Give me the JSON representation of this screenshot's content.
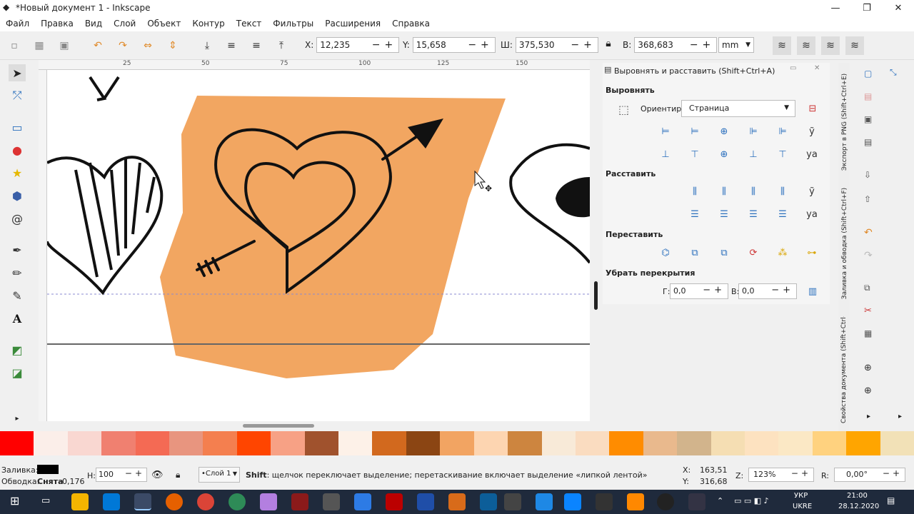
{
  "window": {
    "title": "*Новый документ 1 - Inkscape",
    "min": "—",
    "max": "❐",
    "close": "✕"
  },
  "menu": [
    "Файл",
    "Правка",
    "Вид",
    "Слой",
    "Объект",
    "Контур",
    "Текст",
    "Фильтры",
    "Расширения",
    "Справка"
  ],
  "toolbar": {
    "x_label": "X:",
    "x_value": "12,235",
    "y_label": "Y:",
    "y_value": "15,658",
    "w_label": "Ш:",
    "w_value": "375,530",
    "h_label": "В:",
    "h_value": "368,683",
    "unit": "mm"
  },
  "ruler": {
    "ticks": [
      "25",
      "50",
      "75",
      "100",
      "125",
      "150"
    ]
  },
  "canvas": {
    "accent": "#F2A661"
  },
  "panel": {
    "title": "Выровнять и расставить (Shift+Ctrl+A)",
    "align_header": "Выровнять",
    "relative_label": "Ориентир:",
    "relative_value": "Страница",
    "distribute_header": "Расставить",
    "rearrange_header": "Переставить",
    "overlap_header": "Убрать перекрытия",
    "h_gap_label": "Г:",
    "h_gap_value": "0,0",
    "v_gap_label": "В:",
    "v_gap_value": "0,0"
  },
  "dock_tabs": [
    "Экспорт в PNG (Shift+Ctrl+E)",
    "Заливка и обводка (Shift+Ctrl+F)",
    "Свойства документа (Shift+Ctrl+D)"
  ],
  "palette": [
    "#ff0000",
    "#fbeee9",
    "#f9d7d1",
    "#f08070",
    "#f46a54",
    "#e8957f",
    "#f47f4f",
    "#ff4500",
    "#f7a185",
    "#a0522d",
    "#fdf1e8",
    "#d2691e",
    "#8b4513",
    "#f2a462",
    "#fdd5b1",
    "#cd853f",
    "#f8ead8",
    "#fadcc0",
    "#ff8c00",
    "#e9b98d",
    "#d2b48c",
    "#f5deb3",
    "#fde2c0",
    "#fbe8c5",
    "#ffd27f",
    "#ffa500",
    "#f2e1b7"
  ],
  "status": {
    "fill_label": "Заливка:",
    "stroke_label": "Обводка:",
    "stroke_value": "Снята",
    "stroke_width": "0,176",
    "opacity_label": "Н:",
    "opacity_value": "100",
    "layer": "•Слой 1",
    "message_key": "Shift",
    "message": ": щелчок переключает выделение; перетаскивание включает выделение «липкой лентой»",
    "x_label": "X:",
    "x_coord": "163,51",
    "y_label": "Y:",
    "y_coord": "316,68",
    "zoom_label": "Z:",
    "zoom": "123%",
    "rot_label": "R:",
    "rotation": "0,00°"
  },
  "taskbar": {
    "lang1": "УКР",
    "lang2": "UKRE",
    "time": "21:00",
    "date": "28.12.2020"
  }
}
